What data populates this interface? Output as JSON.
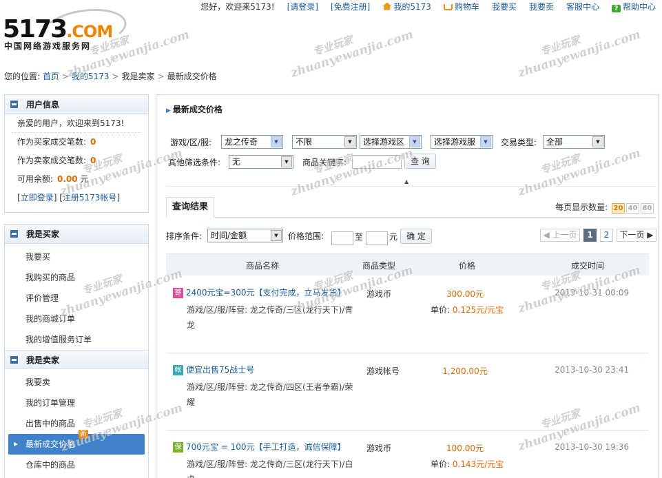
{
  "topnav": {
    "greeting": "您好，欢迎来5173!",
    "login": "[请登录]",
    "register": "[免费注册]",
    "my5173": "我的5173",
    "cart": "购物车",
    "buy": "我要买",
    "sell": "我要卖",
    "service": "客服中心",
    "help": "帮助中心"
  },
  "logo": {
    "brand_main": "5173",
    "brand_suffix": ".COM",
    "tagline": "中国网络游戏服务网"
  },
  "breadcrumb": {
    "prefix": "您的位置:",
    "items": [
      "首页",
      "我的5173",
      "我是卖家",
      "最新成交价格"
    ]
  },
  "sidebar": {
    "userinfo": {
      "title": "用户信息",
      "welcome": "亲爱的用户，欢迎来到5173!",
      "buyer_deals_label": "作为买家成交笔数:",
      "buyer_deals_value": "0",
      "seller_deals_label": "作为卖家成交笔数:",
      "seller_deals_value": "0",
      "balance_label": "可用余额:",
      "balance_value": "0.00",
      "balance_unit": "元",
      "login_link": "立即登录",
      "register_link": "注册5173帐号"
    },
    "buyer": {
      "title": "我是买家",
      "items": [
        "我要买",
        "我购买的商品",
        "评价管理",
        "我的商城订单",
        "我的增值服务订单"
      ]
    },
    "seller": {
      "title": "我是卖家",
      "items": [
        "我要卖",
        "我的订单管理",
        "出售中的商品",
        "最新成交价格",
        "仓库中的商品"
      ],
      "new_badge": "新"
    }
  },
  "main": {
    "title": "最新成交价格",
    "filters": {
      "game_label": "游戏/区/服:",
      "game_value": "龙之传奇",
      "sub_value": "不限",
      "zone_value": "选择游戏区",
      "server_value": "选择游戏服",
      "trade_type_label": "交易类型:",
      "trade_type_value": "全部",
      "other_label": "其他筛选条件:",
      "other_value": "无",
      "keyword_label": "商品关键字:",
      "search_button": "查 询"
    },
    "results_tab": "查询结果",
    "per_page_label": "每页显示数量:",
    "per_page_options": [
      "20",
      "40",
      "80"
    ],
    "sort_label": "排序条件:",
    "sort_value": "时间/金额",
    "price_range_label": "价格范围:",
    "price_to": "至",
    "price_unit": "元",
    "confirm_button": "确 定",
    "pager": {
      "prev": "上一页",
      "page1": "1",
      "page2": "2",
      "next": "下一页"
    },
    "columns": [
      "商品名称",
      "商品类型",
      "价格",
      "成交时间"
    ],
    "rows": [
      {
        "tag": "寄",
        "title": "2400元宝=300元【支付完成，立马发货】",
        "desc": "游戏/区/服/阵营: 龙之传奇/三区(龙行天下)/青龙",
        "type": "游戏币",
        "price": "300.00元",
        "unit_label": "单价:",
        "unit_value": "0.125元/元宝",
        "time": "2013-10-31 00:09"
      },
      {
        "tag": "帐",
        "title": "便宜出售75战士号",
        "desc": "游戏/区/服/阵营: 龙之传奇/四区(王者争霸)/荣耀",
        "type": "游戏帐号",
        "price": "1,200.00元",
        "unit_label": "",
        "unit_value": "",
        "time": "2013-10-30 23:41"
      },
      {
        "tag": "保",
        "title": "700元宝 = 100元【手工打造，诚信保障】",
        "desc": "游戏/区/服/阵营: 龙之传奇/三区(龙行天下)/白虎",
        "type": "游戏币",
        "price": "100.00元",
        "unit_label": "单价:",
        "unit_value": "0.143元/元宝",
        "time": "2013-10-30 19:36"
      }
    ]
  },
  "watermark": {
    "cn": "专业玩家",
    "en": "zhuanyewanjia.com"
  }
}
